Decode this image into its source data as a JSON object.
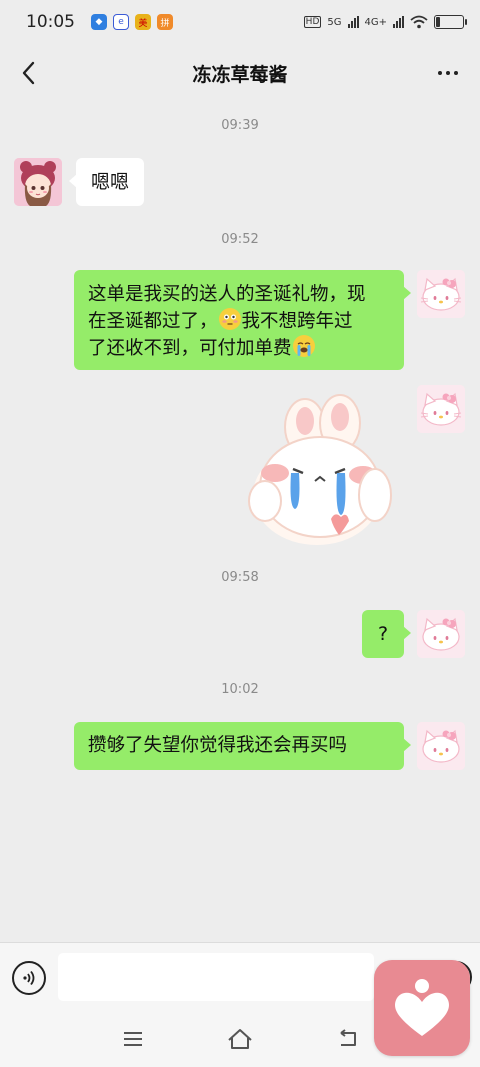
{
  "status_bar": {
    "time": "10:05",
    "hd_label": "HD",
    "net_5g": "5G",
    "net_4g": "4G+"
  },
  "header": {
    "title": "冻冻草莓酱"
  },
  "messages": [
    {
      "type": "timestamp",
      "text": "09:39"
    },
    {
      "type": "incoming",
      "text": "嗯嗯"
    },
    {
      "type": "timestamp",
      "text": "09:52"
    },
    {
      "type": "outgoing",
      "line1": "这单是我买的送人的圣诞礼物，现",
      "line2a": "在圣诞都过了，",
      "emoji1": "flushed-face-emoji",
      "line2b": "我不想跨年过",
      "line3": "了还收不到，可付加单费",
      "emoji2": "loudly-crying-face-emoji"
    },
    {
      "type": "outgoing-sticker",
      "sticker": "crying-bunny-sticker"
    },
    {
      "type": "timestamp",
      "text": "09:58"
    },
    {
      "type": "outgoing",
      "text": "?"
    },
    {
      "type": "timestamp",
      "text": "10:02"
    },
    {
      "type": "outgoing",
      "text": "攒够了失望你觉得我还会再买吗"
    }
  ],
  "input": {
    "value": "",
    "placeholder": ""
  },
  "colors": {
    "background": "#ededed",
    "outgoing_bubble": "#95ec69",
    "incoming_bubble": "#ffffff",
    "timestamp": "#8a8a8a",
    "floating_app": "#e88a92"
  },
  "icons": [
    "back-arrow-icon",
    "more-dots-icon",
    "voice-icon",
    "plus-icon",
    "menu-icon",
    "home-icon",
    "back-nav-icon",
    "heart-person-icon"
  ]
}
